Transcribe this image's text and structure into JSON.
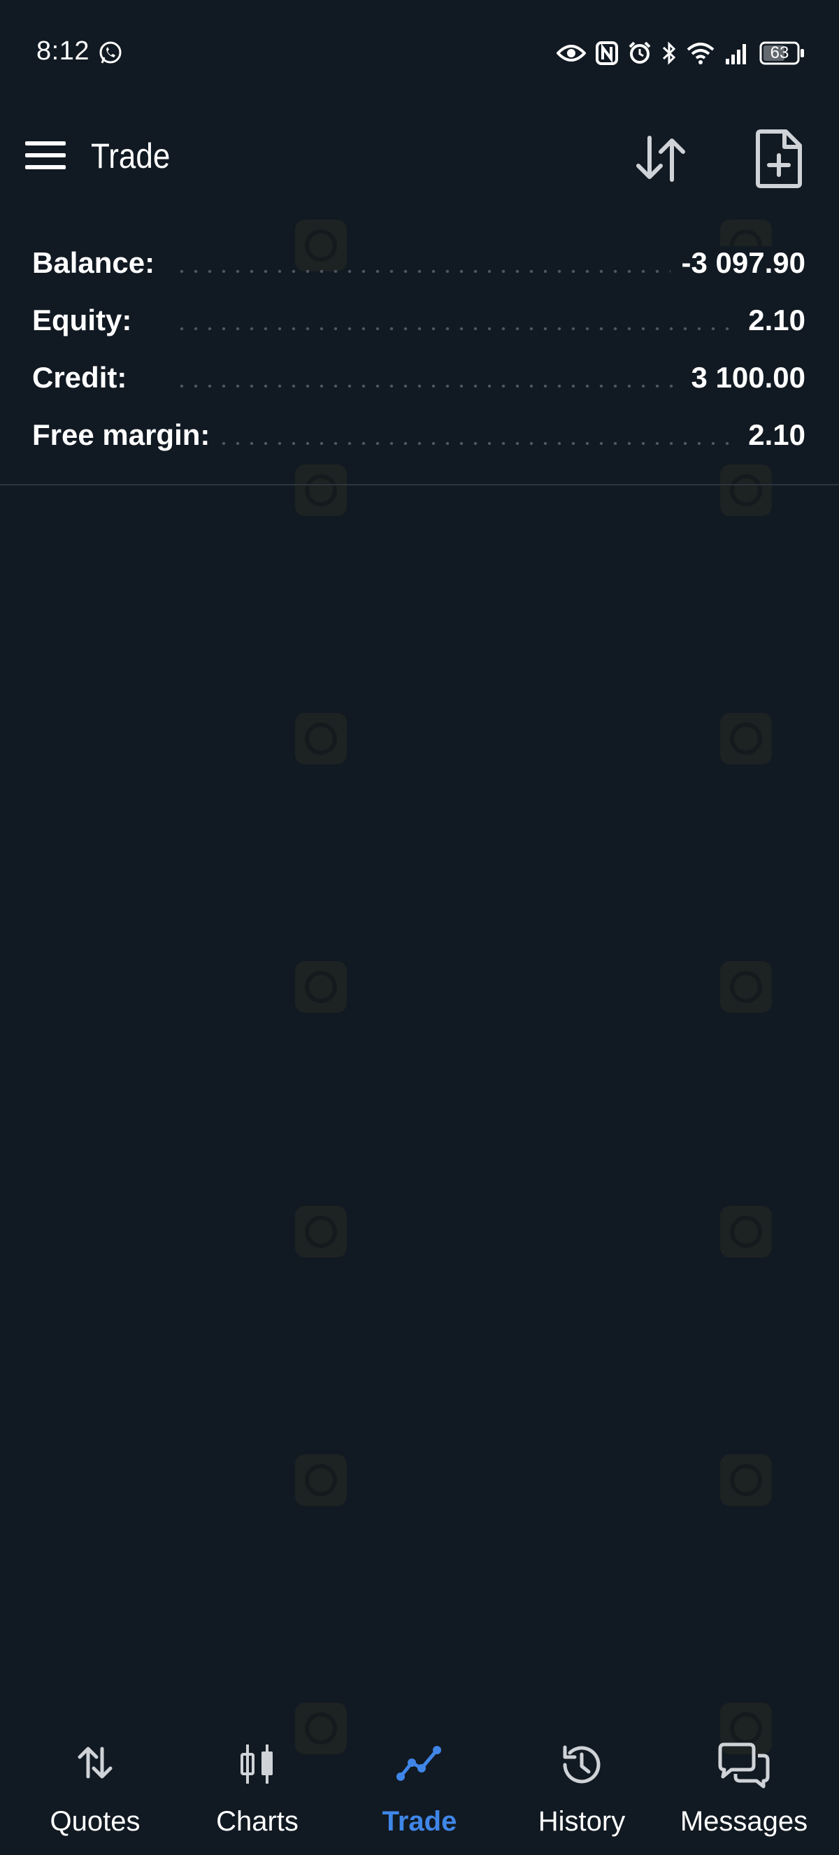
{
  "status_bar": {
    "time": "8:12",
    "battery": "63",
    "icons": [
      "whatsapp-icon",
      "eye-icon",
      "nfc-icon",
      "alarm-icon",
      "bluetooth-icon",
      "wifi-icon",
      "signal-icon",
      "battery-icon"
    ]
  },
  "app_bar": {
    "title": "Trade",
    "icons": [
      "menu-icon",
      "sort-icon",
      "new-order-icon"
    ]
  },
  "summary": [
    {
      "label": "Balance:",
      "value": "-3 097.90"
    },
    {
      "label": "Equity:",
      "value": "2.10"
    },
    {
      "label": "Credit:",
      "value": "3 100.00"
    },
    {
      "label": "Free margin:",
      "value": "2.10"
    }
  ],
  "bottom_nav": {
    "items": [
      {
        "label": "Quotes",
        "icon": "quotes-icon"
      },
      {
        "label": "Charts",
        "icon": "charts-icon"
      },
      {
        "label": "Trade",
        "icon": "trade-icon",
        "active": true
      },
      {
        "label": "History",
        "icon": "history-icon"
      },
      {
        "label": "Messages",
        "icon": "messages-icon"
      }
    ]
  },
  "colors": {
    "background": "#111922",
    "accent": "#3f86e8",
    "text": "#ffffff",
    "divider": "#2c3640"
  }
}
